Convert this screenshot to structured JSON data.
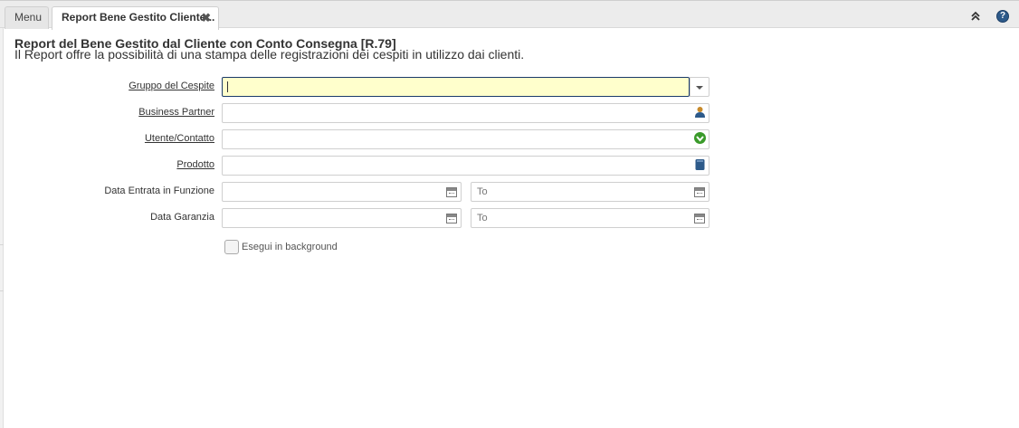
{
  "tabs": {
    "menu_label": "Menu",
    "active_label": "Report Bene Gestito Cliente...",
    "close_symbol": "✖"
  },
  "header": {
    "help_symbol": "?"
  },
  "report": {
    "title": "Report del Bene Gestito dal Cliente con Conto Consegna [R.79]",
    "description": "Il Report offre la possibilità di una stampa delle registrazioni dei cespiti in utilizzo dai clienti."
  },
  "form": {
    "gruppo_label": "Gruppo del Cespite",
    "gruppo_value": "",
    "bp_label": "Business Partner",
    "bp_value": "",
    "utente_label": "Utente/Contatto",
    "utente_value": "",
    "prodotto_label": "Prodotto",
    "prodotto_value": "",
    "data_entrata_label": "Data Entrata in Funzione",
    "data_garanzia_label": "Data Garanzia",
    "to_placeholder": "To",
    "background_label": "Esegui in background",
    "background_checked": false
  },
  "icons": {
    "collapse": "double-chevron-up-icon",
    "help": "help-icon",
    "dropdown": "chevron-down-icon",
    "bp": "business-partner-icon",
    "user": "user-contact-icon",
    "product": "product-icon",
    "calendar": "calendar-icon"
  },
  "colors": {
    "active_field_bg": "#ffffcc",
    "active_field_border": "#1a3a6a",
    "help_icon": "#2d5a8a",
    "user_icon": "#3a9a2a",
    "bp_icon": "#c88a2a",
    "product_icon": "#2d5a8a"
  }
}
